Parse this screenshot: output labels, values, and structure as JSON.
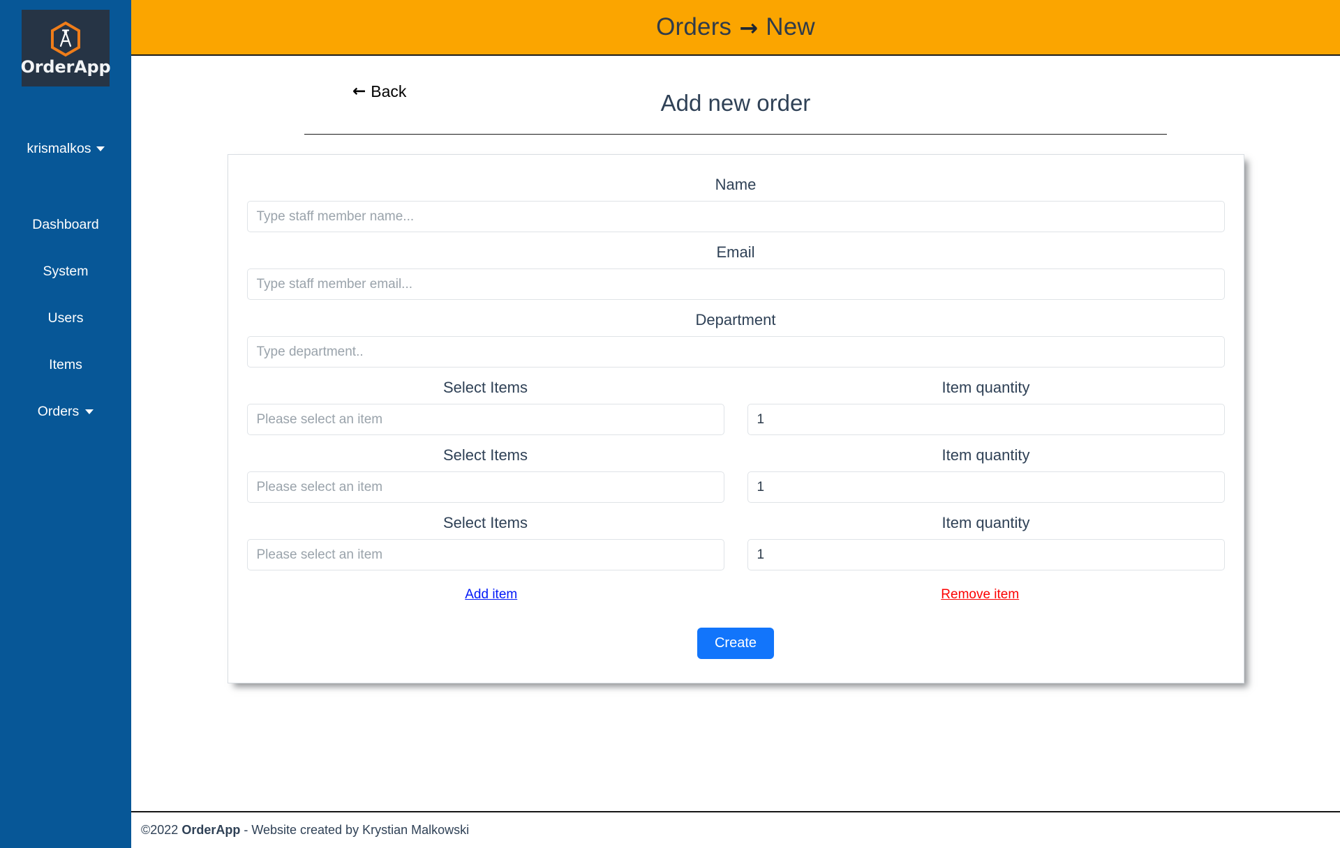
{
  "brand": {
    "logo_text": "OrderApp",
    "logo_icon": "hexagon-compass-icon"
  },
  "topbar": {
    "breadcrumb_from": "Orders",
    "breadcrumb_arrow": "→",
    "breadcrumb_to": "New",
    "background_color": "#fba500",
    "text_color": "#2f3b4a"
  },
  "sidebar": {
    "background_color": "#075797",
    "user": {
      "label": "krismalkos",
      "caret_icon": "chevron-down-icon"
    },
    "items": [
      {
        "label": "Dashboard",
        "has_caret": false
      },
      {
        "label": "System",
        "has_caret": false
      },
      {
        "label": "Users",
        "has_caret": false
      },
      {
        "label": "Items",
        "has_caret": false
      },
      {
        "label": "Orders",
        "has_caret": true
      }
    ]
  },
  "page": {
    "back_label": "Back",
    "back_icon": "arrow-left-icon",
    "title": "Add new order"
  },
  "form": {
    "name": {
      "label": "Name",
      "placeholder": "Type staff member name...",
      "value": ""
    },
    "email": {
      "label": "Email",
      "placeholder": "Type staff member email...",
      "value": ""
    },
    "department": {
      "label": "Department",
      "placeholder": "Type department..",
      "value": ""
    },
    "item_rows": [
      {
        "select_label": "Select Items",
        "select_placeholder": "Please select an item",
        "select_value": "",
        "quantity_label": "Item quantity",
        "quantity_value": "1"
      },
      {
        "select_label": "Select Items",
        "select_placeholder": "Please select an item",
        "select_value": "",
        "quantity_label": "Item quantity",
        "quantity_value": "1"
      },
      {
        "select_label": "Select Items",
        "select_placeholder": "Please select an item",
        "select_value": "",
        "quantity_label": "Item quantity",
        "quantity_value": "1"
      }
    ],
    "add_item_label": "Add item",
    "add_item_color": "#0018f8",
    "remove_item_label": "Remove item",
    "remove_item_color": "#fc0000",
    "submit_label": "Create",
    "submit_color": "#1275fb"
  },
  "footer": {
    "copyright": "©2022 ",
    "brand": "OrderApp",
    "tail": " - Website created by Krystian Malkowski"
  }
}
